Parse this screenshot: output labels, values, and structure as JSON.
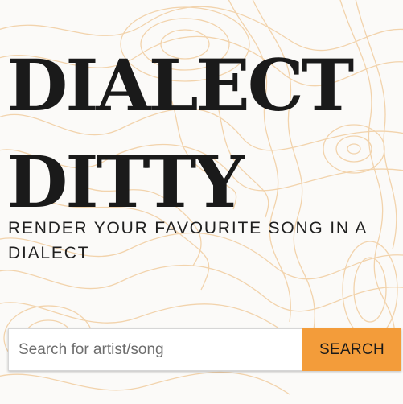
{
  "header": {
    "title_line_1": "DIALECT",
    "title_line_2": "DITTY",
    "subtitle": "RENDER YOUR FAVOURITE SONG IN A DIALECT"
  },
  "search": {
    "placeholder": "Search for artist/song",
    "value": "",
    "button_label": "SEARCH"
  },
  "colors": {
    "accent": "#f39c3a",
    "background": "#fbfaf8",
    "contour_lines": "#f2d3ac",
    "text": "#1a1a1a"
  }
}
